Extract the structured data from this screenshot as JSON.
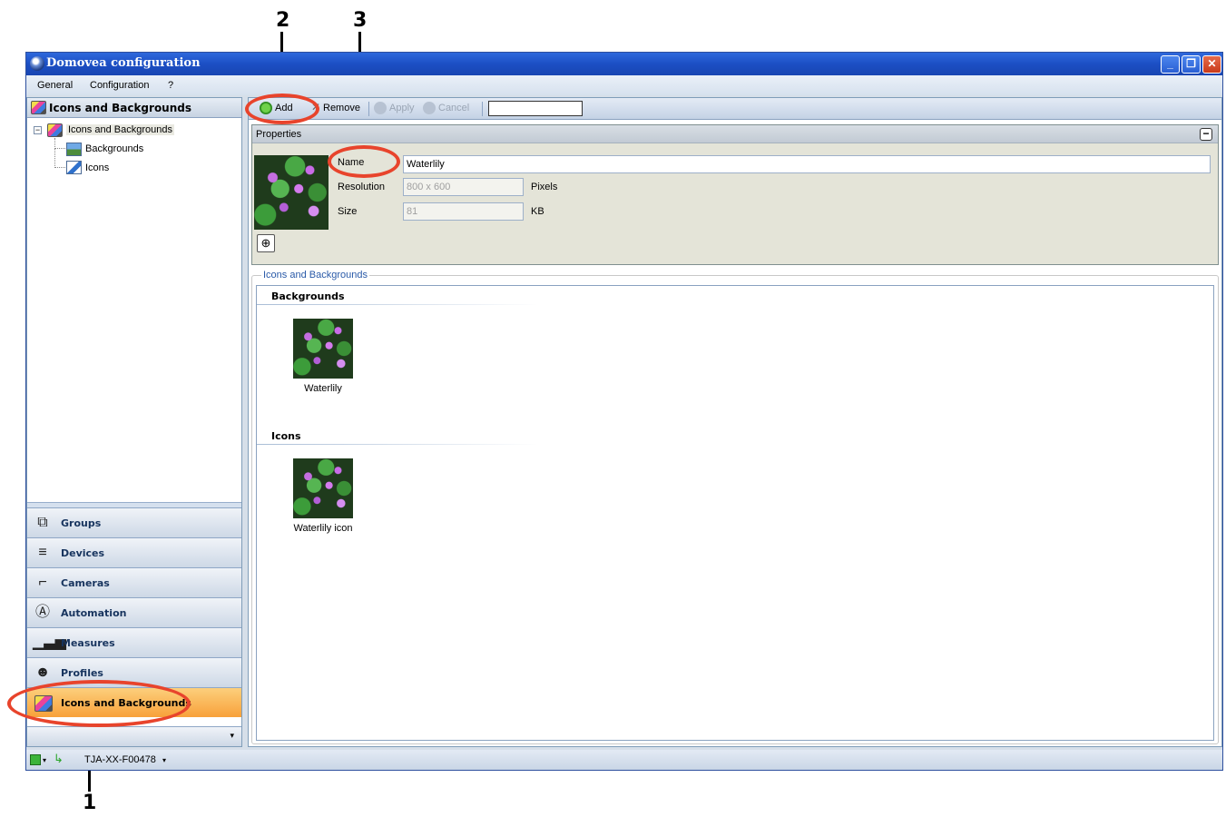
{
  "callouts": [
    "1",
    "2",
    "3"
  ],
  "window": {
    "title": "Domovea configuration",
    "minimize": "_",
    "restore": "❐",
    "close": "✕"
  },
  "menu": [
    "General",
    "Configuration",
    "?"
  ],
  "nav": {
    "header": "Icons and Backgrounds",
    "tree": {
      "root": "Icons and Backgrounds",
      "children": [
        "Backgrounds",
        "Icons"
      ]
    },
    "buttons": [
      {
        "label": "Groups",
        "icon": "groups-icon"
      },
      {
        "label": "Devices",
        "icon": "devices-icon"
      },
      {
        "label": "Cameras",
        "icon": "camera-icon"
      },
      {
        "label": "Automation",
        "icon": "automation-icon"
      },
      {
        "label": "Measures",
        "icon": "measures-icon"
      },
      {
        "label": "Profiles",
        "icon": "profiles-icon"
      },
      {
        "label": "Icons and Backgrounds",
        "icon": "icons-backgrounds-icon"
      }
    ],
    "active": "Icons and Backgrounds"
  },
  "toolbar": {
    "add": "Add",
    "remove": "Remove",
    "apply": "Apply",
    "cancel": "Cancel",
    "search_value": ""
  },
  "properties": {
    "title": "Properties",
    "name_label": "Name",
    "name_value": "Waterlily",
    "resolution_label": "Resolution",
    "resolution_value": "800 x 600",
    "resolution_unit": "Pixels",
    "size_label": "Size",
    "size_value": "81",
    "size_unit": "KB"
  },
  "gallery": {
    "legend": "Icons and Backgrounds",
    "groups": [
      {
        "title": "Backgrounds",
        "items": [
          "Waterlily"
        ]
      },
      {
        "title": "Icons",
        "items": [
          "Waterlily icon"
        ]
      }
    ]
  },
  "status": {
    "device": "TJA-XX-F00478"
  },
  "colors": {
    "accent": "#e8442c",
    "active_nav": "#f8a13a",
    "titlebar": "#1c4fc4"
  }
}
